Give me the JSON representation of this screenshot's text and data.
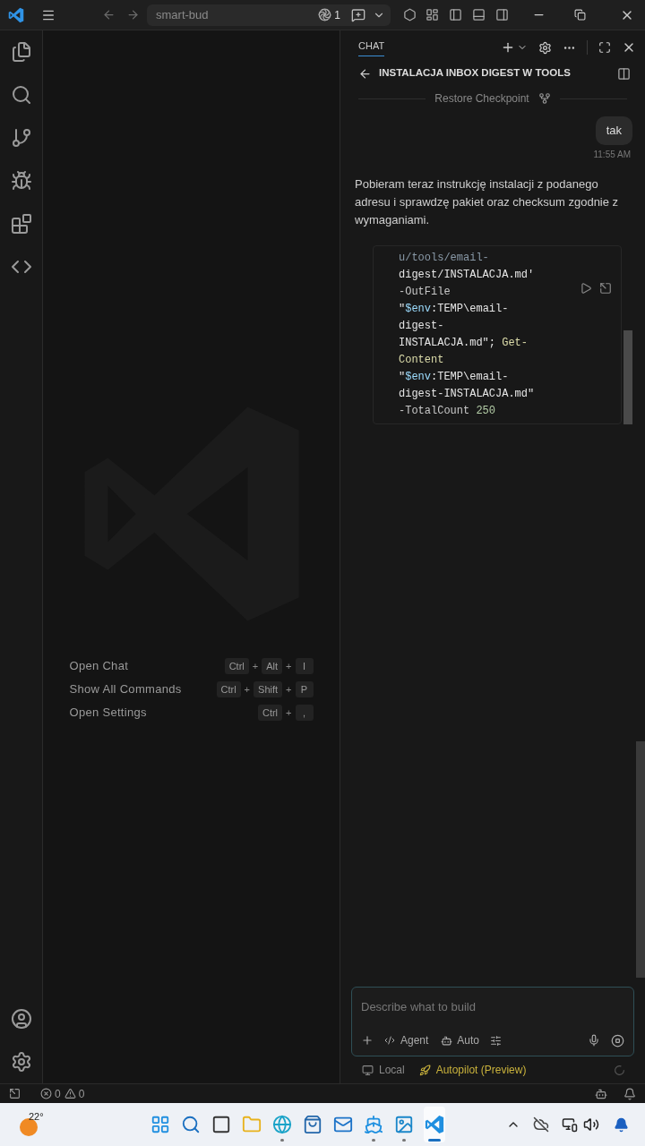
{
  "title_bar": {
    "search": "smart-bud",
    "sessions_count": "1"
  },
  "editor": {
    "shortcuts": [
      {
        "label": "Open Chat",
        "keys": [
          "Ctrl",
          "Alt",
          "I"
        ],
        "separators": [
          "+",
          "+"
        ]
      },
      {
        "label": "Show All Commands",
        "keys": [
          "Ctrl",
          "Shift",
          "P"
        ],
        "separators": [
          "+",
          "+"
        ]
      },
      {
        "label": "Open Settings",
        "keys": [
          "Ctrl",
          ","
        ],
        "separators": [
          "+"
        ]
      }
    ]
  },
  "chat": {
    "tab": "CHAT",
    "title": "INSTALACJA INBOX DIGEST W TOOLS",
    "checkpoint": "Restore Checkpoint",
    "user_message": {
      "text": "tak",
      "time": "11:55 AM"
    },
    "assistant_message": {
      "text": "Pobieram teraz instrukcję instalacji z podanego adresu i sprawdzę pakiet oraz checksum zgodnie z wymaganiami.",
      "code": [
        [
          {
            "text": "u/tools/email-",
            "kind": "faded"
          }
        ],
        [
          {
            "text": "digest/INSTALACJA.md'",
            "kind": "string"
          }
        ],
        [
          {
            "text": "-OutFile",
            "kind": "param"
          }
        ],
        [
          {
            "text": "\"",
            "kind": "string"
          },
          {
            "text": "$env",
            "kind": "variable"
          },
          {
            "text": ":TEMP\\email-",
            "kind": "string"
          }
        ],
        [
          {
            "text": "digest-",
            "kind": "string"
          }
        ],
        [
          {
            "text": "INSTALACJA.md\"; ",
            "kind": "string"
          },
          {
            "text": "Get-",
            "kind": "command"
          }
        ],
        [
          {
            "text": "Content",
            "kind": "command"
          }
        ],
        [
          {
            "text": "\"",
            "kind": "string"
          },
          {
            "text": "$env",
            "kind": "variable"
          },
          {
            "text": ":TEMP\\email-",
            "kind": "string"
          }
        ],
        [
          {
            "text": "digest-INSTALACJA.md\"",
            "kind": "string"
          }
        ],
        [
          {
            "text": "-TotalCount ",
            "kind": "param"
          },
          {
            "text": "250",
            "kind": "number"
          }
        ]
      ]
    },
    "input": {
      "placeholder": "Describe what to build",
      "mode": "Agent",
      "model": "Auto"
    },
    "footer": {
      "location": "Local",
      "autopilot": "Autopilot (Preview)"
    }
  },
  "status_bar": {
    "errors": "0",
    "warnings": "0"
  },
  "taskbar": {
    "temperature": "22°",
    "apps": [
      {
        "kind": "start",
        "running": false,
        "selected": false
      },
      {
        "kind": "search",
        "running": false,
        "selected": false
      },
      {
        "kind": "taskview",
        "running": false,
        "selected": false
      },
      {
        "kind": "explorer",
        "running": false,
        "selected": false
      },
      {
        "kind": "browser",
        "running": true,
        "selected": false
      },
      {
        "kind": "store",
        "running": false,
        "selected": false
      },
      {
        "kind": "mail",
        "running": false,
        "selected": false
      },
      {
        "kind": "docker",
        "running": true,
        "selected": false
      },
      {
        "kind": "photos",
        "running": true,
        "selected": false
      },
      {
        "kind": "vscode",
        "running": true,
        "selected": true
      }
    ]
  }
}
